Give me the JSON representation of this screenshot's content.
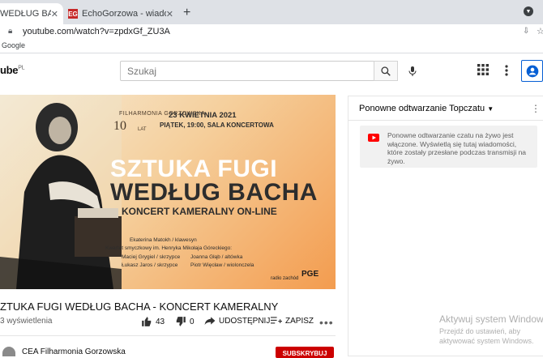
{
  "browser": {
    "tabs": [
      {
        "label": "WEDŁUG BACHA -",
        "active": true
      },
      {
        "label": "EchoGorzowa - wiadomości z Go",
        "active": false,
        "favicon": "EG"
      }
    ],
    "url": "youtube.com/watch?v=zpdxGf_ZU3A",
    "bookmark": "Google"
  },
  "yt": {
    "logo": "ube",
    "region": "PL",
    "search_placeholder": "Szukaj"
  },
  "video": {
    "thumbnail": {
      "orchestra_name": "FILHARMONIA GORZOWSKA",
      "anniversary_number": "10",
      "anniversary_unit": "LAT",
      "date": "23 KWIETNIA 2021",
      "time_place": "PIĄTEK, 19:00, SALA KONCERTOWA",
      "title_line1": "SZTUKA FUGI",
      "title_line2": "WEDŁUG BACHA",
      "subtitle": "KONCERT KAMERALNY ON-LINE",
      "performer": "Ekaterina Matokh / klawesyn",
      "quartet": "Kwartet smyczkowy im. Henryka Mikołaja Góreckiego:",
      "musicians_left": [
        "Maciej Grygiel / skrzypce",
        "Łukasz Jaros / skrzypce"
      ],
      "musicians_right": [
        "Joanna Głąb / altówka",
        "Piotr Więcław / wiolonczela"
      ],
      "sponsor_radio": "radio zachód",
      "sponsor_pge": "PGE"
    },
    "title": "ZTUKA FUGI WEDŁUG BACHA - KONCERT KAMERALNY",
    "views": "3 wyświetlenia",
    "likes": "43",
    "dislikes": "0",
    "share_label": "UDOSTĘPNIJ",
    "save_label": "ZAPISZ",
    "more_label": "•••",
    "channel": "CEA Filharmonia Gorzowska",
    "subscribe_label": "SUBSKRYBUJ"
  },
  "chat": {
    "title": "Ponowne odtwarzanie Topczatu",
    "notice": "Ponowne odtwarzanie czatu na żywo jest włączone. Wyświetlą się tutaj wiadomości, które zostały przesłane podczas transmisji na żywo."
  },
  "watermark": {
    "title": "Aktywuj system Windows",
    "subtitle": "Przejdź do ustawień, aby aktywować system Windows."
  }
}
